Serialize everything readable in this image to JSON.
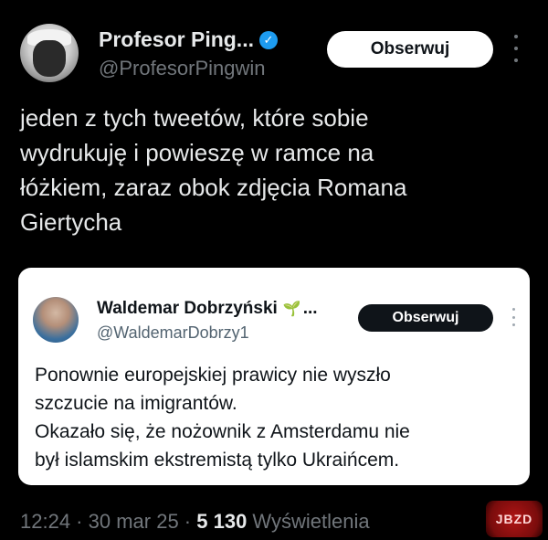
{
  "tweet": {
    "author_name": "Profesor Ping...",
    "author_handle": "@ProfesorPingwin",
    "verified_mark": "✓",
    "follow_label": "Obserwuj",
    "text": "jeden z tych tweetów, które sobie\nwydrukuję i powieszę w ramce na\nłóżkiem, zaraz obok zdjęcia Romana\nGiertycha"
  },
  "quoted": {
    "author_name": "Waldemar Dobrzyński",
    "sprout_icon": "🌱",
    "ellipsis": "...",
    "author_handle": "@WaldemarDobrzy1",
    "follow_label": "Obserwuj",
    "text": "Ponownie europejskiej prawicy nie wyszło\nszczucie na imigrantów.\nOkazało się, że nożownik z Amsterdamu nie\nbył islamskim ekstremistą tylko Ukraińcem."
  },
  "meta": {
    "time": "12:24",
    "sep1": " · ",
    "date": "30 mar 25",
    "sep2": " · ",
    "views_count": "5 130",
    "views_label": " Wyświetlenia"
  },
  "watermark": {
    "text": "JBZD"
  },
  "colors": {
    "accent": "#1d9bf0",
    "background": "#000000",
    "muted": "#71767b"
  }
}
